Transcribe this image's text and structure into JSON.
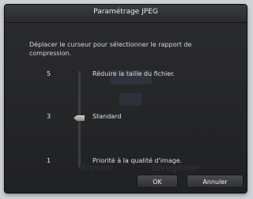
{
  "dialog": {
    "title": "Paramétrage JPEG",
    "instruction": "Déplacer le curseur pour sélectionner le rapport de compression."
  },
  "slider": {
    "value": 3,
    "min": 1,
    "max": 5,
    "ticks": [
      {
        "number": "5",
        "label": "Réduire la taille du fichier."
      },
      {
        "number": "3",
        "label": "Standard"
      },
      {
        "number": "1",
        "label": "Priorité à la qualité d'image."
      }
    ]
  },
  "buttons": {
    "ok": "OK",
    "cancel": "Annuler"
  },
  "background_ghost": {
    "cancel": "Annuler",
    "save": "Enregistrer"
  },
  "colors": {
    "dialog_bg": "#202123",
    "titlebar_bg": "#2a2b2d",
    "text": "#e0e0e0"
  }
}
